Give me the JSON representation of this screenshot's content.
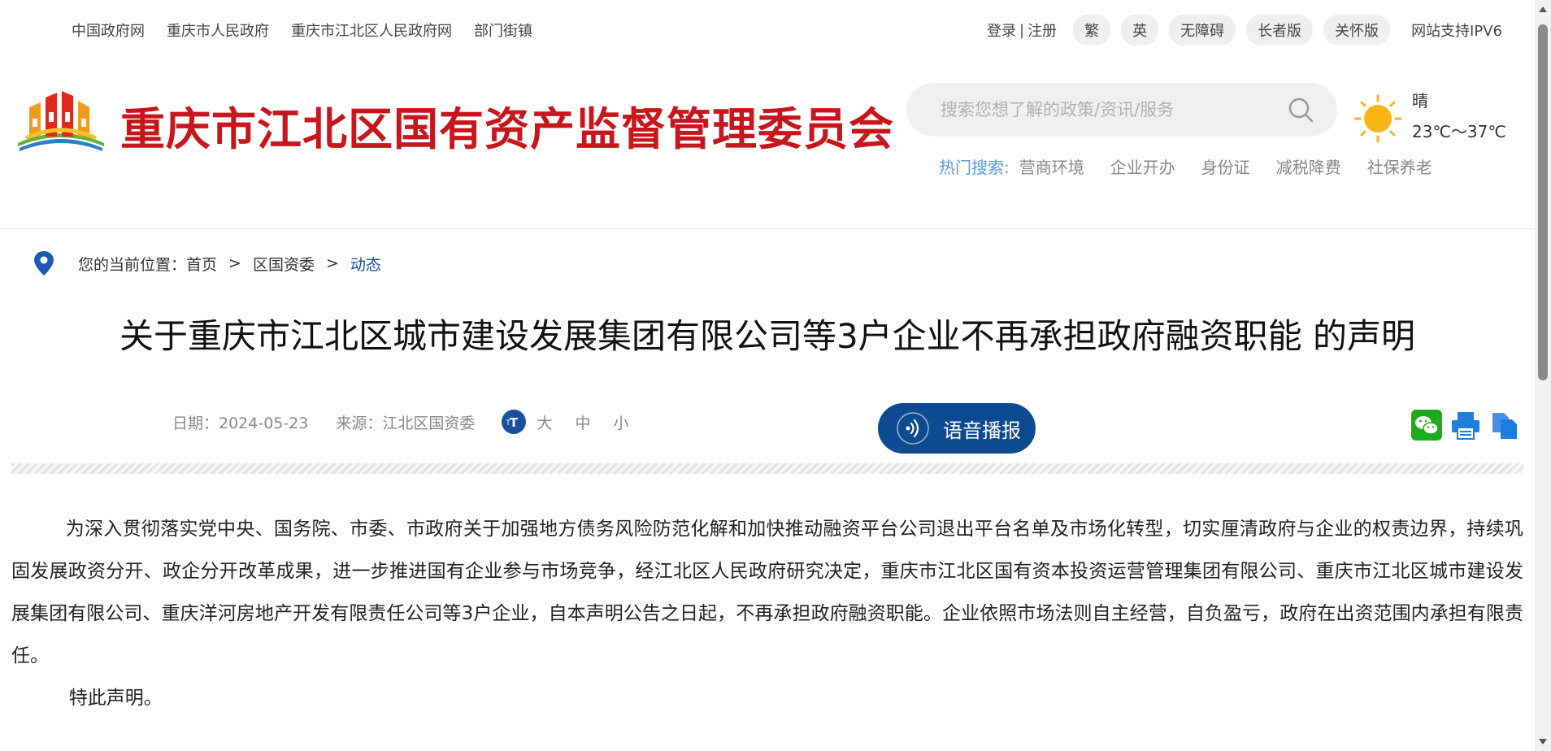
{
  "topbar": {
    "links": [
      "中国政府网",
      "重庆市人民政府",
      "重庆市江北区人民政府网",
      "部门街镇"
    ],
    "login": "登录",
    "login_sep": "|",
    "register": "注册",
    "modes": [
      "繁",
      "英",
      "无障碍",
      "长者版",
      "关怀版"
    ],
    "ipv6": "网站支持IPV6"
  },
  "header": {
    "site_title": "重庆市江北区国有资产监督管理委员会",
    "search_placeholder": "搜索您想了解的政策/资讯/服务",
    "weather": {
      "condition": "晴",
      "temp": "23℃～37℃"
    },
    "hot_label": "热门搜索:",
    "hot_keywords": [
      "营商环境",
      "企业开办",
      "身份证",
      "减税降费",
      "社保养老"
    ]
  },
  "breadcrumb": {
    "prefix": "您的当前位置：",
    "items": [
      "首页",
      "区国资委",
      "动态"
    ],
    "sep": ">"
  },
  "article": {
    "title": "关于重庆市江北区城市建设发展集团有限公司等3户企业不再承担政府融资职能 的声明",
    "date": "日期：2024-05-23",
    "source": "来源：江北区国资委",
    "font_sizes": [
      "大",
      "中",
      "小"
    ],
    "voice_label": "语音播报",
    "paragraphs": [
      "为深入贯彻落实党中央、国务院、市委、市政府关于加强地方债务风险防范化解和加快推动融资平台公司退出平台名单及市场化转型，切实厘清政府与企业的权责边界，持续巩固发展政资分开、政企分开改革成果，进一步推进国有企业参与市场竞争，经江北区人民政府研究决定，重庆市江北区国有资本投资运营管理集团有限公司、重庆市江北区城市建设发展集团有限公司、重庆洋河房地产开发有限责任公司等3户企业，自本声明公告之日起，不再承担政府融资职能。企业依照市场法则自主经营，自负盈亏，政府在出资范围内承担有限责任。",
      "特此声明。"
    ]
  },
  "colors": {
    "title_red": "#c8161d",
    "accent_blue": "#0d4a8f",
    "link_blue": "#1a4fa0",
    "hot_blue": "#5b9bd5"
  },
  "icons": [
    "logo-emblem",
    "search-icon",
    "sun-icon",
    "location-pin-icon",
    "font-size-icon",
    "voice-icon",
    "wechat-icon",
    "print-icon",
    "copy-icon"
  ]
}
